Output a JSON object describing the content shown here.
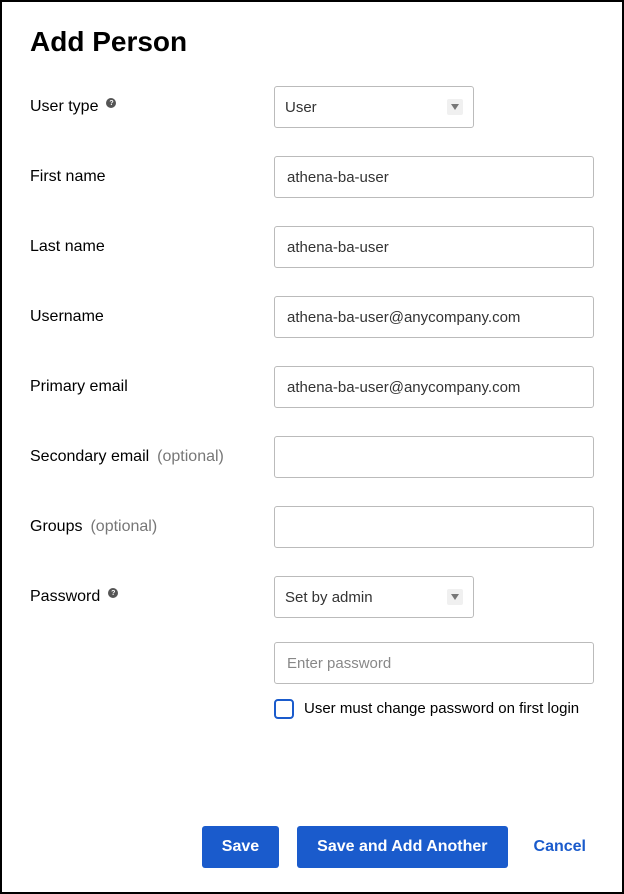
{
  "title": "Add Person",
  "fields": {
    "user_type": {
      "label": "User type",
      "value": "User",
      "has_help": true
    },
    "first_name": {
      "label": "First name",
      "value": "athena-ba-user"
    },
    "last_name": {
      "label": "Last name",
      "value": "athena-ba-user"
    },
    "username": {
      "label": "Username",
      "value": "athena-ba-user@anycompany.com"
    },
    "primary_email": {
      "label": "Primary email",
      "value": "athena-ba-user@anycompany.com"
    },
    "secondary_email": {
      "label": "Secondary email",
      "optional_text": "(optional)",
      "value": ""
    },
    "groups": {
      "label": "Groups",
      "optional_text": "(optional)",
      "value": ""
    },
    "password": {
      "label": "Password",
      "has_help": true,
      "mode_value": "Set by admin",
      "placeholder": "Enter password",
      "value": "",
      "checkbox_label": "User must change password on first login",
      "checkbox_checked": false
    }
  },
  "buttons": {
    "save": "Save",
    "save_another": "Save and Add Another",
    "cancel": "Cancel"
  }
}
